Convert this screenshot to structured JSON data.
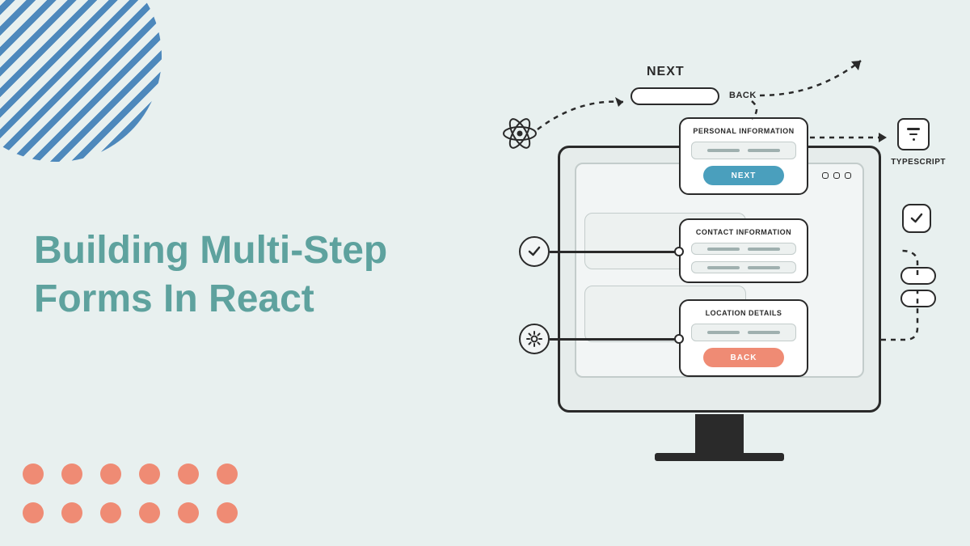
{
  "title": "Building Multi-Step Forms In React",
  "illustration": {
    "top_actions": {
      "next": "NEXT",
      "back": "BACK"
    },
    "cards": [
      {
        "header": "PERSONAL INFORMATION",
        "button": "NEXT",
        "button_style": "blue"
      },
      {
        "header": "CONTACT INFORMATION"
      },
      {
        "header": "LOCATION DETAILS",
        "button": "BACK",
        "button_style": "salmon"
      }
    ],
    "typescript_label": "TYPESCRIPT"
  }
}
